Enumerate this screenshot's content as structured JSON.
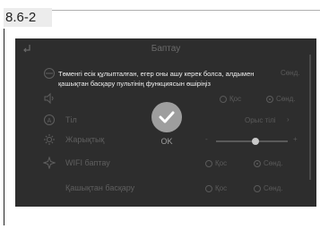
{
  "section_label": "8.6-2",
  "screen": {
    "title": "Баптау",
    "message": "Төменгі есік құлыпталған, егер оны ашу керек болса, алдымен қашықтан басқару пультінің функциясын өшіріңіз",
    "ok_label": "OK",
    "rows": {
      "sound": {
        "opt_off": "Қос",
        "opt_on": "Сөнд."
      },
      "language": {
        "label": "Тіл",
        "value": "Орыс тілі"
      },
      "brightness": {
        "label": "Жарықтық",
        "minus": "-",
        "plus": "+",
        "level": 0.55
      },
      "wifi": {
        "label": "WIFI баптау",
        "opt_off": "Қос",
        "opt_on": "Сөнд."
      },
      "remote": {
        "label": "Қашықтан басқару",
        "opt_off": "Қос",
        "opt_on": "Сөнд."
      }
    },
    "colors": {
      "background": "#2d2d2d",
      "text_dim": "#5f5f5f",
      "message_text": "#f0f0f0"
    }
  }
}
